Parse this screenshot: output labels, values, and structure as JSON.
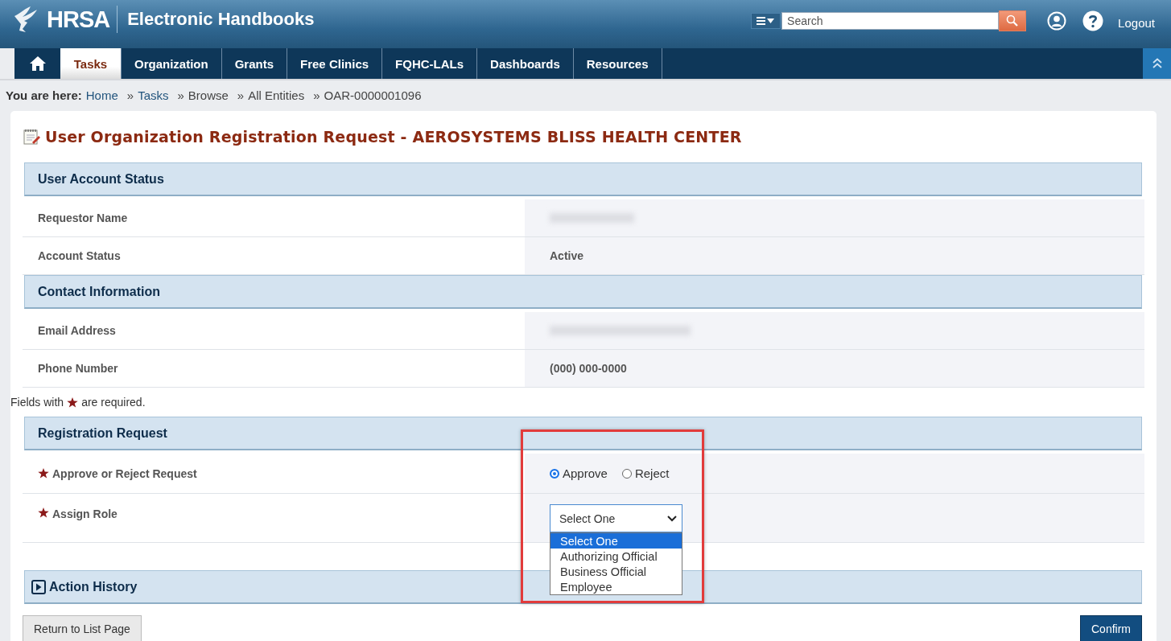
{
  "header": {
    "logo": "HRSA",
    "app_title": "Electronic Handbooks",
    "search": {
      "placeholder": "Search"
    },
    "logout": "Logout"
  },
  "nav": {
    "items": [
      {
        "kind": "home",
        "selected": false
      },
      {
        "kind": "tab",
        "label": "Tasks",
        "selected": true
      },
      {
        "kind": "tab",
        "label": "Organization",
        "selected": false
      },
      {
        "kind": "tab",
        "label": "Grants",
        "selected": false
      },
      {
        "kind": "tab",
        "label": "Free Clinics",
        "selected": false
      },
      {
        "kind": "tab",
        "label": "FQHC-LALs",
        "selected": false
      },
      {
        "kind": "tab",
        "label": "Dashboards",
        "selected": false
      },
      {
        "kind": "tab",
        "label": "Resources",
        "selected": false
      }
    ]
  },
  "breadcrumb": {
    "label": "You are here:",
    "separator": "»",
    "items": [
      {
        "label": "Home",
        "kind": "link"
      },
      {
        "label": "Tasks",
        "kind": "link"
      },
      {
        "label": "Browse",
        "kind": "text"
      },
      {
        "label": "All Entities",
        "kind": "text"
      },
      {
        "label": "OAR-0000001096",
        "kind": "text"
      }
    ]
  },
  "page_title": "User Organization Registration Request - AEROSYSTEMS BLISS HEALTH CENTER",
  "sections": [
    {
      "title": "User Account Status",
      "rows": [
        {
          "label": "Requestor Name",
          "redacted": true
        },
        {
          "label": "Account Status",
          "value": "Active"
        }
      ]
    },
    {
      "title": "Contact Information",
      "rows": [
        {
          "label": "Email Address",
          "redacted": true
        },
        {
          "label": "Phone Number",
          "value": "(000) 000-0000"
        }
      ]
    }
  ],
  "required_note": {
    "before": "Fields with",
    "after": "are required."
  },
  "registration": {
    "title": "Registration Request",
    "decision": {
      "label": "Approve or Reject Request",
      "required": true,
      "options": [
        {
          "label": "Approve",
          "selected": true
        },
        {
          "label": "Reject",
          "selected": false
        }
      ]
    },
    "role": {
      "label": "Assign Role",
      "required": true,
      "value": "Select One",
      "expanded": true,
      "options": [
        {
          "label": "Select One",
          "selected": true
        },
        {
          "label": "Authorizing Official",
          "selected": false
        },
        {
          "label": "Business Official",
          "selected": false
        },
        {
          "label": "Employee",
          "selected": false
        }
      ]
    }
  },
  "highlight": true,
  "action_history": {
    "title": "Action History",
    "expanded": false
  },
  "buttons": {
    "back": "Return to List Page",
    "confirm": "Confirm"
  }
}
